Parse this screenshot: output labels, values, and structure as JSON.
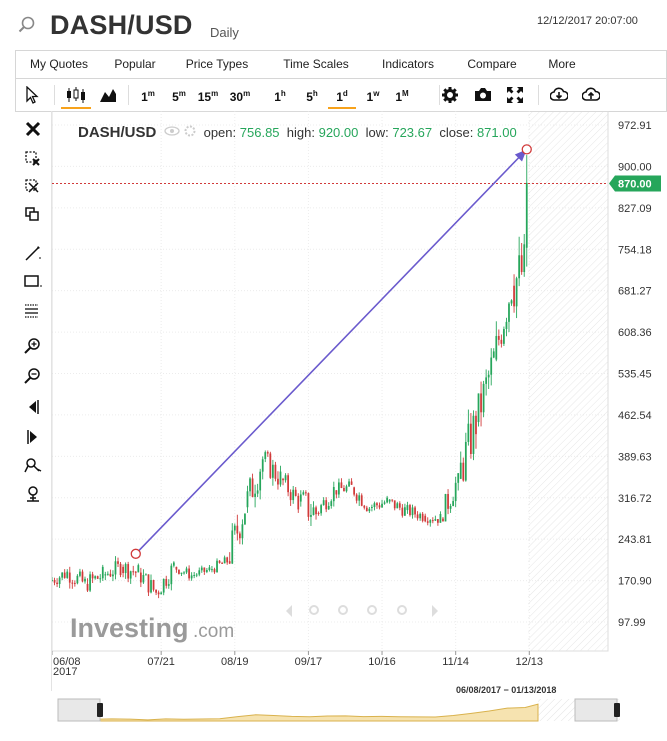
{
  "header": {
    "symbol": "DASH/USD",
    "period": "Daily",
    "datetime": "12/12/2017 20:07:00"
  },
  "menu": [
    "My Quotes",
    "Popular",
    "Price Types",
    "Time Scales",
    "Indicators",
    "Compare",
    "More"
  ],
  "timeframes": [
    {
      "n": "1",
      "u": "m"
    },
    {
      "n": "5",
      "u": "m"
    },
    {
      "n": "15",
      "u": "m"
    },
    {
      "n": "30",
      "u": "m"
    },
    {
      "n": "1",
      "u": "h"
    },
    {
      "n": "5",
      "u": "h"
    },
    {
      "n": "1",
      "u": "d"
    },
    {
      "n": "1",
      "u": "w"
    },
    {
      "n": "1",
      "u": "M"
    }
  ],
  "legend": {
    "symbol": "DASH/USD",
    "open_label": "open:",
    "open": "756.85",
    "high_label": "high:",
    "high": "920.00",
    "low_label": "low:",
    "low": "723.67",
    "close_label": "close:",
    "close": "871.00"
  },
  "watermark": {
    "brand": "Investing",
    "suffix": ".com"
  },
  "navigator": {
    "range_label": "06/08/2017 − 01/13/2018"
  },
  "colors": {
    "up": "#26a65b",
    "down": "#d13a3a",
    "accent": "#f7a21b",
    "trendline": "#6a5acd",
    "price_line": "#d13a3a"
  },
  "chart_data": {
    "type": "candlestick",
    "y_ticks": [
      "972.91",
      "900.00",
      "827.09",
      "754.18",
      "681.27",
      "608.36",
      "535.45",
      "462.54",
      "389.63",
      "316.72",
      "243.81",
      "170.90",
      "97.99"
    ],
    "ylim": [
      97.99,
      972.91
    ],
    "y_scale": "linear",
    "x_tick_labels": [
      {
        "label": "06/08\n2017",
        "date": "2017-06-08"
      },
      {
        "label": "07/21",
        "date": "2017-07-21"
      },
      {
        "label": "08/19",
        "date": "2017-08-19"
      },
      {
        "label": "09/17",
        "date": "2017-09-17"
      },
      {
        "label": "10/16",
        "date": "2017-10-16"
      },
      {
        "label": "11/14",
        "date": "2017-11-14"
      },
      {
        "label": "12/13",
        "date": "2017-12-13"
      }
    ],
    "xlim": [
      "2017-06-08",
      "2018-01-13"
    ],
    "current_price": "870.00",
    "trendline": {
      "from": {
        "date": "2017-07-11",
        "price": 218
      },
      "to": {
        "date": "2017-12-12",
        "price": 930
      }
    },
    "weekly_ohlc": [
      {
        "date": "2017-06-08",
        "o": 170,
        "h": 195,
        "l": 145,
        "c": 185
      },
      {
        "date": "2017-06-15",
        "o": 185,
        "h": 210,
        "l": 150,
        "c": 165
      },
      {
        "date": "2017-06-22",
        "o": 165,
        "h": 200,
        "l": 140,
        "c": 180
      },
      {
        "date": "2017-06-29",
        "o": 180,
        "h": 215,
        "l": 160,
        "c": 195
      },
      {
        "date": "2017-07-06",
        "o": 195,
        "h": 225,
        "l": 165,
        "c": 185
      },
      {
        "date": "2017-07-13",
        "o": 185,
        "h": 200,
        "l": 135,
        "c": 150
      },
      {
        "date": "2017-07-20",
        "o": 150,
        "h": 205,
        "l": 140,
        "c": 195
      },
      {
        "date": "2017-07-27",
        "o": 195,
        "h": 205,
        "l": 170,
        "c": 180
      },
      {
        "date": "2017-08-03",
        "o": 180,
        "h": 200,
        "l": 170,
        "c": 190
      },
      {
        "date": "2017-08-10",
        "o": 190,
        "h": 215,
        "l": 180,
        "c": 205
      },
      {
        "date": "2017-08-17",
        "o": 205,
        "h": 320,
        "l": 200,
        "c": 300
      },
      {
        "date": "2017-08-24",
        "o": 300,
        "h": 410,
        "l": 290,
        "c": 385
      },
      {
        "date": "2017-08-31",
        "o": 385,
        "h": 400,
        "l": 320,
        "c": 350
      },
      {
        "date": "2017-09-07",
        "o": 350,
        "h": 360,
        "l": 290,
        "c": 310
      },
      {
        "date": "2017-09-14",
        "o": 310,
        "h": 330,
        "l": 220,
        "c": 290
      },
      {
        "date": "2017-09-21",
        "o": 290,
        "h": 345,
        "l": 285,
        "c": 330
      },
      {
        "date": "2017-09-28",
        "o": 330,
        "h": 355,
        "l": 310,
        "c": 335
      },
      {
        "date": "2017-10-05",
        "o": 335,
        "h": 345,
        "l": 290,
        "c": 300
      },
      {
        "date": "2017-10-12",
        "o": 300,
        "h": 320,
        "l": 275,
        "c": 310
      },
      {
        "date": "2017-10-19",
        "o": 310,
        "h": 325,
        "l": 280,
        "c": 295
      },
      {
        "date": "2017-10-26",
        "o": 295,
        "h": 310,
        "l": 270,
        "c": 285
      },
      {
        "date": "2017-11-02",
        "o": 285,
        "h": 295,
        "l": 255,
        "c": 280
      },
      {
        "date": "2017-11-09",
        "o": 280,
        "h": 360,
        "l": 275,
        "c": 350
      },
      {
        "date": "2017-11-16",
        "o": 350,
        "h": 500,
        "l": 345,
        "c": 450
      },
      {
        "date": "2017-11-23",
        "o": 450,
        "h": 580,
        "l": 440,
        "c": 560
      },
      {
        "date": "2017-11-30",
        "o": 560,
        "h": 700,
        "l": 555,
        "c": 690
      },
      {
        "date": "2017-12-07",
        "o": 690,
        "h": 810,
        "l": 620,
        "c": 720
      },
      {
        "date": "2017-12-12",
        "o": 756.85,
        "h": 920,
        "l": 723.67,
        "c": 871
      }
    ]
  }
}
